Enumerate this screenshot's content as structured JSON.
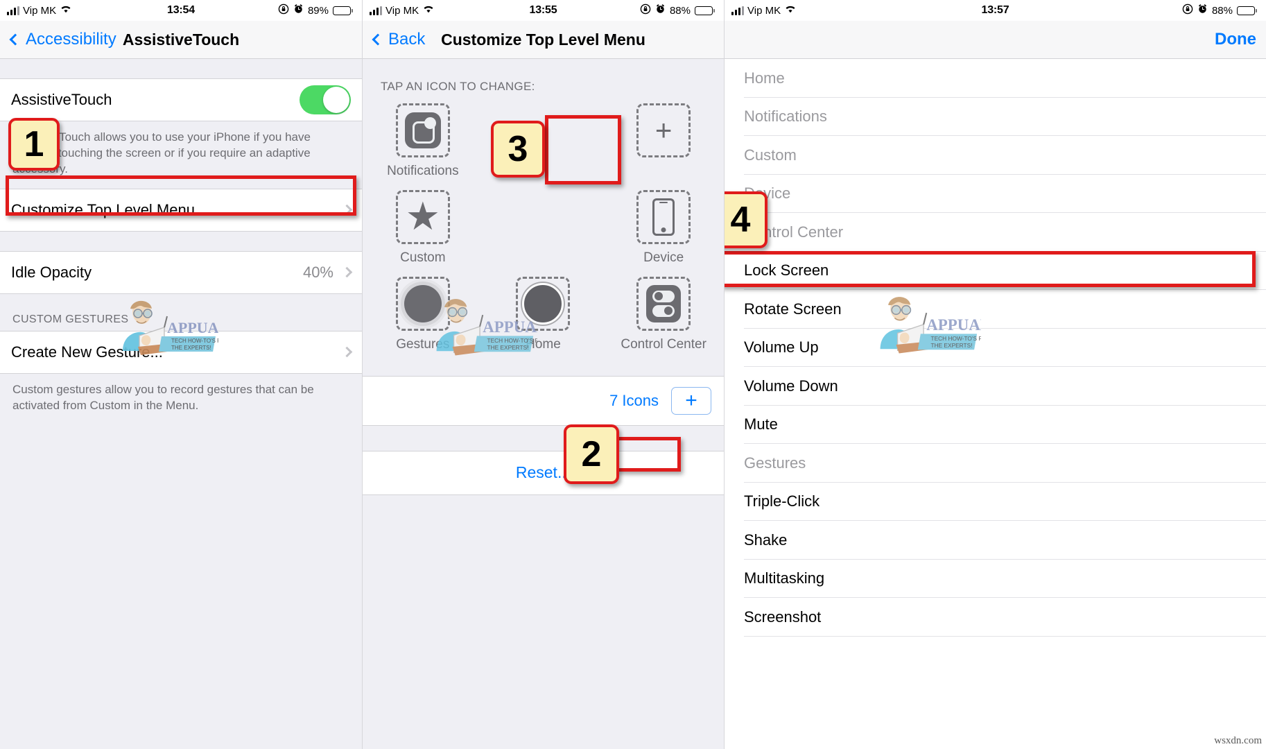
{
  "panel1": {
    "status": {
      "carrier": "Vip MK",
      "time": "13:54",
      "battery_pct": "89%"
    },
    "nav": {
      "back_label": "Accessibility",
      "title": "AssistiveTouch"
    },
    "assistivetouch_row": {
      "label": "AssistiveTouch",
      "toggle_state": "on"
    },
    "description": "AssistiveTouch allows you to use your iPhone if you have difficulty touching the screen or if you require an adaptive accessory.",
    "customize_row": {
      "label": "Customize Top Level Menu..."
    },
    "idle_opacity_row": {
      "label": "Idle Opacity",
      "value": "40%"
    },
    "custom_gestures_header": "CUSTOM GESTURES",
    "create_gesture_row": {
      "label": "Create New Gesture..."
    },
    "gestures_footnote": "Custom gestures allow you to record gestures that can be activated from Custom in the Menu."
  },
  "panel2": {
    "status": {
      "carrier": "Vip MK",
      "time": "13:55",
      "battery_pct": "88%"
    },
    "nav": {
      "back_label": "Back",
      "title": "Customize Top Level Menu"
    },
    "tap_label": "TAP AN ICON TO CHANGE:",
    "icons": [
      {
        "label": "Notifications",
        "icon": "notifications-icon"
      },
      {
        "label": "",
        "icon": "plus-icon"
      },
      {
        "label": "Custom",
        "icon": "star-icon"
      },
      {
        "label": "Device",
        "icon": "device-icon"
      },
      {
        "label": "Gestures",
        "icon": "gestures-icon"
      },
      {
        "label": "Home",
        "icon": "home-icon"
      },
      {
        "label": "Control Center",
        "icon": "control-center-icon"
      }
    ],
    "count_label": "7 Icons",
    "add_button": "+",
    "reset_label": "Reset..."
  },
  "panel3": {
    "status": {
      "carrier": "Vip MK",
      "time": "13:57",
      "battery_pct": "88%"
    },
    "nav": {
      "done_label": "Done"
    },
    "items": [
      {
        "label": "Home",
        "disabled": true
      },
      {
        "label": "Notifications",
        "disabled": true
      },
      {
        "label": "Custom",
        "disabled": true
      },
      {
        "label": "Device",
        "disabled": true
      },
      {
        "label": "Control Center",
        "disabled": true
      },
      {
        "label": "Lock Screen",
        "disabled": false
      },
      {
        "label": "Rotate Screen",
        "disabled": false
      },
      {
        "label": "Volume Up",
        "disabled": false
      },
      {
        "label": "Volume Down",
        "disabled": false
      },
      {
        "label": "Mute",
        "disabled": false
      },
      {
        "label": "Gestures",
        "disabled": true
      },
      {
        "label": "Triple-Click",
        "disabled": false
      },
      {
        "label": "Shake",
        "disabled": false
      },
      {
        "label": "Multitasking",
        "disabled": false
      },
      {
        "label": "Screenshot",
        "disabled": false
      }
    ]
  },
  "annotations": {
    "badge1": "1",
    "badge2": "2",
    "badge3": "3",
    "badge4": "4"
  },
  "watermark": {
    "brand": "APPUALS",
    "tagline_line1": "TECH HOW-TO'S FROM",
    "tagline_line2": "THE EXPERTS!"
  },
  "credit": "wsxdn.com",
  "colors": {
    "accent_blue": "#007AFF",
    "toggle_green": "#4CD964",
    "badge_fill": "#FBF0B9",
    "badge_border": "#E01B1B"
  }
}
